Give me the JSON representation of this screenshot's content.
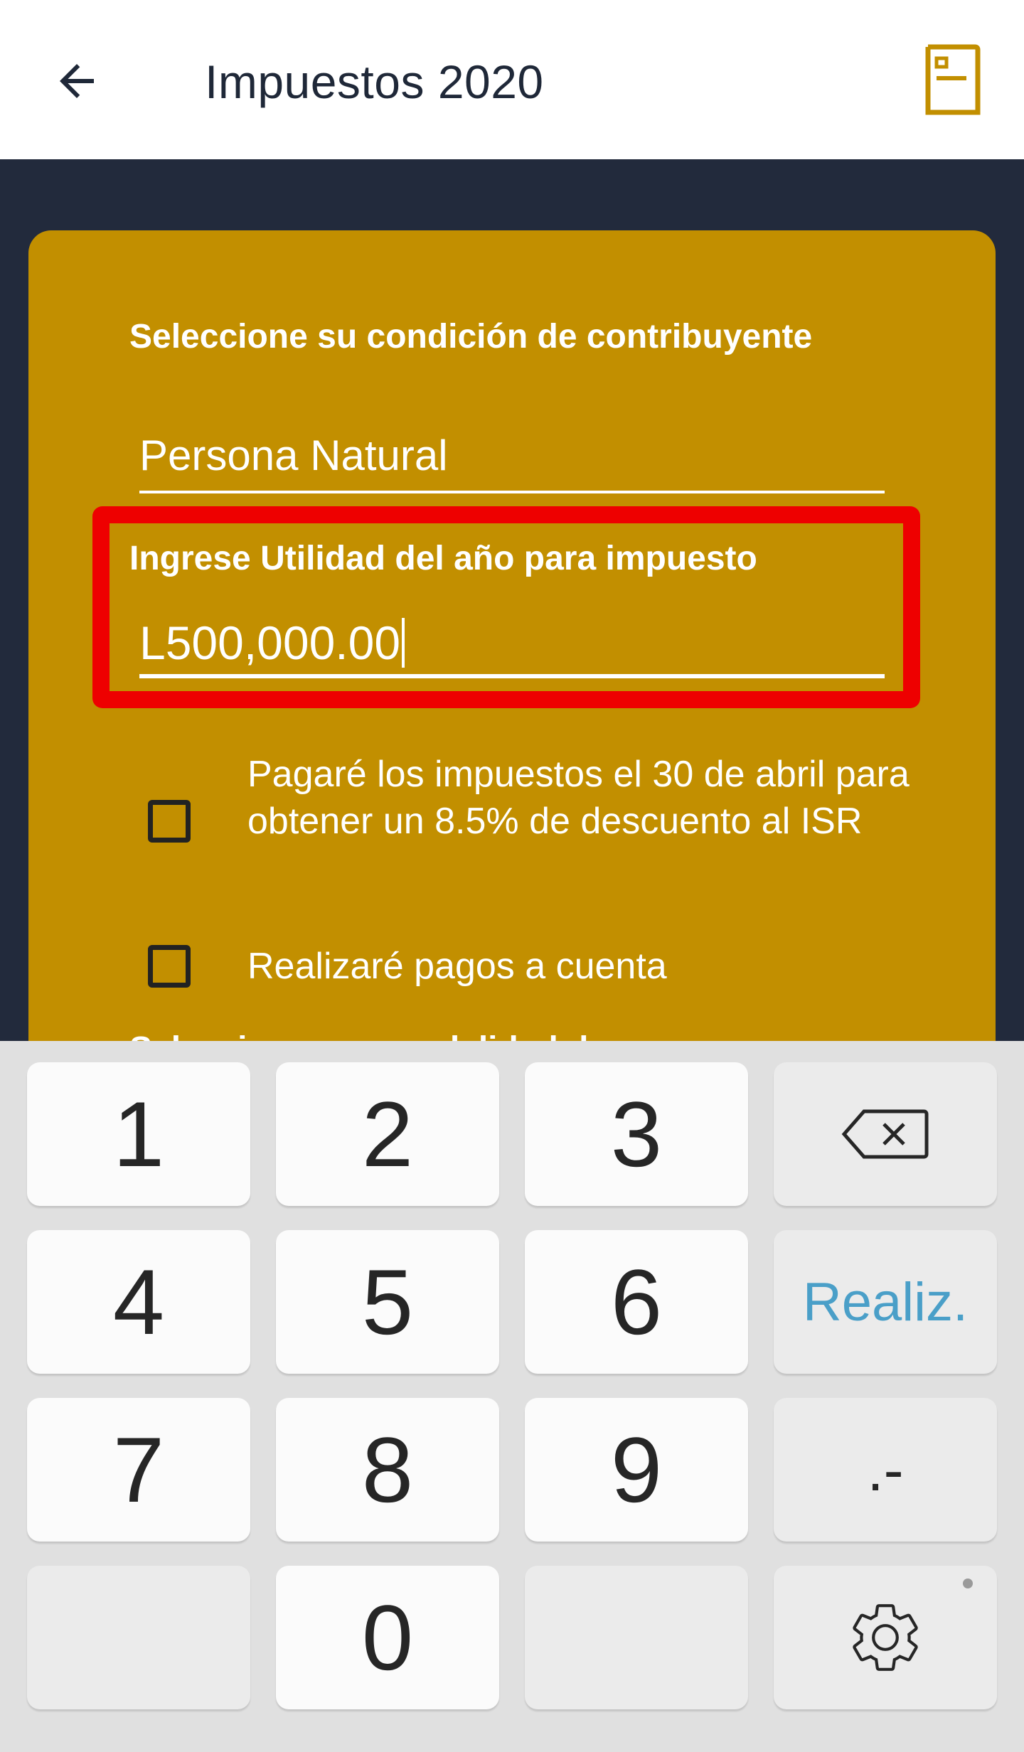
{
  "app_bar": {
    "title": "Impuestos 2020",
    "back_icon": "arrow-left-icon",
    "action_icon": "document-icon",
    "accent_color": "#c28f00"
  },
  "form": {
    "card_color": "#c28f00",
    "condition_label": "Seleccione su condición de contribuyente",
    "condition_value": "Persona Natural",
    "income_label": "Ingrese Utilidad del año para impuesto",
    "income_value": "L500,000.00",
    "highlight_color": "#ee0000",
    "checkbox_discount": {
      "label": "Pagaré los impuestos el 30 de abril para obtener un 8.5% de descuento al ISR",
      "checked": false
    },
    "checkbox_advance": {
      "label": "Realizaré pagos a cuenta",
      "checked": false
    },
    "next_label_partial": "Seleccione una modalidad de"
  },
  "keyboard": {
    "keys": {
      "k1": "1",
      "k2": "2",
      "k3": "3",
      "k4": "4",
      "k5": "5",
      "k6": "6",
      "k7": "7",
      "k8": "8",
      "k9": "9",
      "k0": "0",
      "done": "Realiz.",
      "punct": ".-"
    },
    "backspace_icon": "backspace-icon",
    "settings_icon": "gear-icon",
    "done_color": "#4a9fc8"
  }
}
